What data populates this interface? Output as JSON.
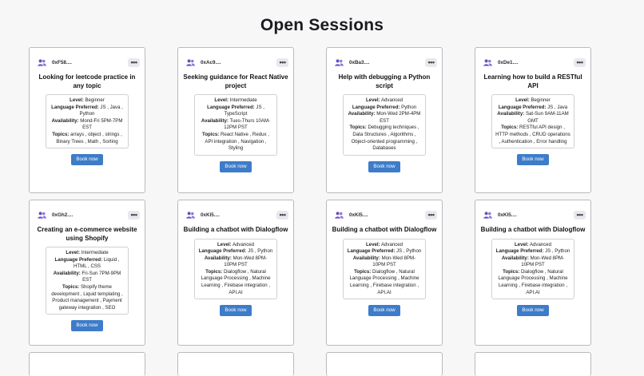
{
  "page": {
    "title": "Open Sessions"
  },
  "actions": {
    "book_label": "Book now",
    "more_glyph": "•••"
  },
  "labels": {
    "level": "Level:",
    "language": "Language Preferred:",
    "availability": "Availability:",
    "topics": "Topics:"
  },
  "sessions": [
    {
      "address": "0xF58....",
      "title": "Looking for leetcode practice in any topic",
      "level": "Beginner",
      "language": "JS , Java , Python",
      "availability": "Mond-Fri 5PM-7PM EST",
      "topics": "arrays , object , strings , Binary Trees , Math , Sorting"
    },
    {
      "address": "0xAc9....",
      "title": "Seeking guidance for React Native project",
      "level": "Intermediate",
      "language": "JS , TypeScript",
      "availability": "Tues-Thurs 10AM-12PM PST",
      "topics": "React Native , Redux , API integration , Navigation , Styling"
    },
    {
      "address": "0xBa3....",
      "title": "Help with debugging a Python script",
      "level": "Advanced",
      "language": "Python",
      "availability": "Mon-Wed 2PM-4PM EST",
      "topics": "Debugging techniques , Data Structures , Algorithms , Object-oriented programming , Databases"
    },
    {
      "address": "0xDe1....",
      "title": "Learning how to build a RESTful API",
      "level": "Beginner",
      "language": "JS , Java",
      "availability": "Sat-Sun 9AM-11AM GMT",
      "topics": "RESTful API design , HTTP methods , CRUD operations , Authentication , Error handling"
    },
    {
      "address": "0xGh2....",
      "title": "Creating an e-commerce website using Shopify",
      "level": "Intermediate",
      "language": "Liquid , HTML , CSS",
      "availability": "Fri-Sun 7PM-9PM EST",
      "topics": "Shopify theme development , Liquid templating , Product management , Payment gateway integration , SEO"
    },
    {
      "address": "0xKl5....",
      "title": "Building a chatbot with Dialogflow",
      "level": "Advanced",
      "language": "JS , Python",
      "availability": "Mon-Wed 8PM-10PM PST",
      "topics": "Dialogflow , Natural Language Processing , Machine Learning , Firebase integration , API.AI"
    },
    {
      "address": "0xKl5....",
      "title": "Building a chatbot with Dialogflow",
      "level": "Advanced",
      "language": "JS , Python",
      "availability": "Mon-Wed 8PM-10PM PST",
      "topics": "Dialogflow , Natural Language Processing , Machine Learning , Firebase integration , API.AI"
    },
    {
      "address": "0xKl5....",
      "title": "Building a chatbot with Dialogflow",
      "level": "Advanced",
      "language": "JS , Python",
      "availability": "Mon-Wed 8PM-10PM PST",
      "topics": "Dialogflow , Natural Language Processing , Machine Learning , Firebase integration , API.AI"
    }
  ]
}
